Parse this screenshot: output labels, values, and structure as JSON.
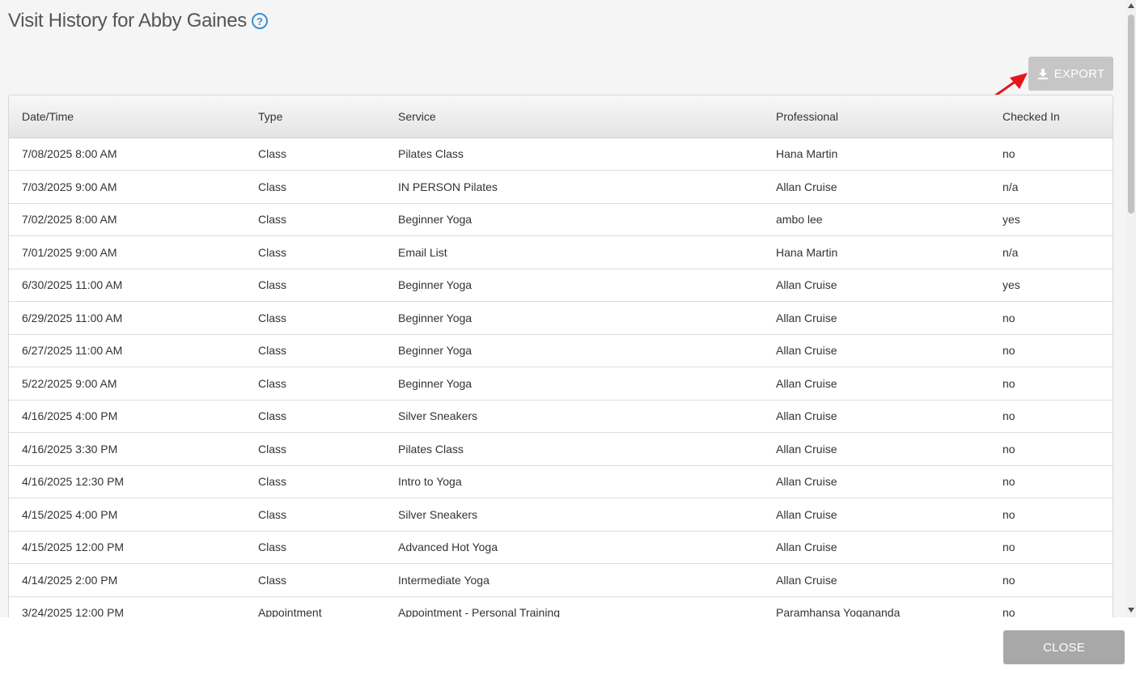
{
  "header": {
    "title": "Visit History for Abby Gaines",
    "help_icon": "question-circle-icon"
  },
  "toolbar": {
    "export_label": "EXPORT",
    "export_icon": "download-icon"
  },
  "table": {
    "columns": [
      "Date/Time",
      "Type",
      "Service",
      "Professional",
      "Checked In"
    ],
    "rows": [
      [
        "7/08/2025 8:00 AM",
        "Class",
        "Pilates Class",
        "Hana Martin",
        "no"
      ],
      [
        "7/03/2025 9:00 AM",
        "Class",
        "IN PERSON Pilates",
        "Allan Cruise",
        "n/a"
      ],
      [
        "7/02/2025 8:00 AM",
        "Class",
        "Beginner Yoga",
        "ambo lee",
        "yes"
      ],
      [
        "7/01/2025 9:00 AM",
        "Class",
        "Email List",
        "Hana Martin",
        "n/a"
      ],
      [
        "6/30/2025 11:00 AM",
        "Class",
        "Beginner Yoga",
        "Allan Cruise",
        "yes"
      ],
      [
        "6/29/2025 11:00 AM",
        "Class",
        "Beginner Yoga",
        "Allan Cruise",
        "no"
      ],
      [
        "6/27/2025 11:00 AM",
        "Class",
        "Beginner Yoga",
        "Allan Cruise",
        "no"
      ],
      [
        "5/22/2025 9:00 AM",
        "Class",
        "Beginner Yoga",
        "Allan Cruise",
        "no"
      ],
      [
        "4/16/2025 4:00 PM",
        "Class",
        "Silver Sneakers",
        "Allan Cruise",
        "no"
      ],
      [
        "4/16/2025 3:30 PM",
        "Class",
        "Pilates Class",
        "Allan Cruise",
        "no"
      ],
      [
        "4/16/2025 12:30 PM",
        "Class",
        "Intro to Yoga",
        "Allan Cruise",
        "no"
      ],
      [
        "4/15/2025 4:00 PM",
        "Class",
        "Silver Sneakers",
        "Allan Cruise",
        "no"
      ],
      [
        "4/15/2025 12:00 PM",
        "Class",
        "Advanced Hot Yoga",
        "Allan Cruise",
        "no"
      ],
      [
        "4/14/2025 2:00 PM",
        "Class",
        "Intermediate Yoga",
        "Allan Cruise",
        "no"
      ],
      [
        "3/24/2025 12:00 PM",
        "Appointment",
        "Appointment - Personal Training",
        "Paramhansa Yogananda",
        "no"
      ]
    ]
  },
  "footer": {
    "close_label": "CLOSE"
  },
  "colors": {
    "accent": "#3b8fd4",
    "annotation_arrow": "#e8141c",
    "button_disabled": "#c6c6c6"
  }
}
